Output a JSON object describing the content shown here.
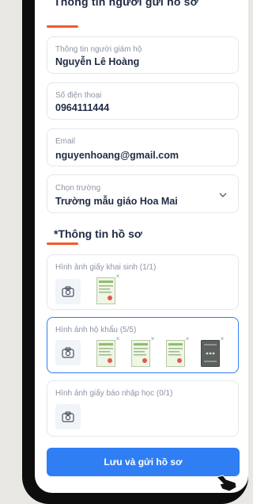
{
  "header": {
    "clipped_title": "Thông tin người gửi hồ sơ"
  },
  "fields": [
    {
      "label": "Thông tin người giám hộ",
      "value": "Nguyễn Lê Hoàng"
    },
    {
      "label": "Số điện thoại",
      "value": "0964111444"
    },
    {
      "label": "Email",
      "value": "nguyenhoang@gmail.com"
    },
    {
      "label": "Chọn trường",
      "value": "Trường mẫu giáo Hoa Mai"
    }
  ],
  "section": {
    "title": "*Thông tin hồ sơ"
  },
  "uploads": [
    {
      "label": "Hình ảnh giấy khai sinh (1/1)"
    },
    {
      "label": "Hình ảnh hộ khẩu (5/5)"
    },
    {
      "label": "Hình ảnh giấy báo nhập học (0/1)"
    }
  ],
  "remove_glyph": "×",
  "actions": {
    "save_label": "Lưu và gửi hồ sơ"
  },
  "colors": {
    "accent": "#f15a2b",
    "primary": "#2f7ef4"
  }
}
